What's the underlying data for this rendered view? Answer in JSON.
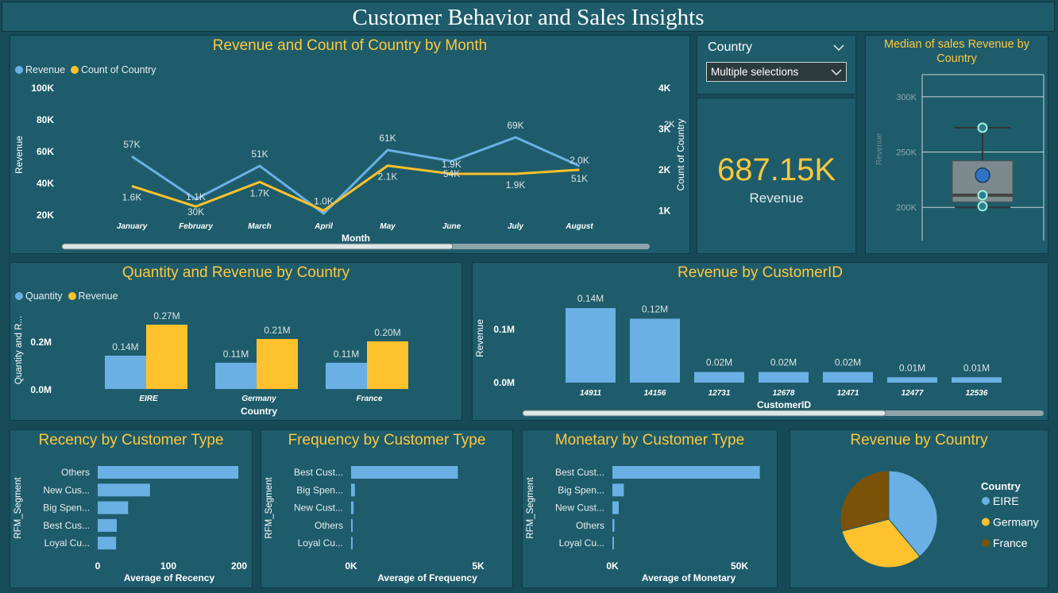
{
  "page_title": "Customer Behavior and Sales Insights",
  "colors": {
    "blue": "#6ab0e4",
    "yellow": "#ffc12c",
    "brown": "#7a5208",
    "title": "#ffc83d",
    "panel": "#1e5c6b",
    "background": "#164a57"
  },
  "slicer": {
    "label": "Country",
    "value": "Multiple selections",
    "icon": "chevron-down-icon"
  },
  "kpi": {
    "value": "687.15K",
    "label": "Revenue"
  },
  "chart_data": [
    {
      "id": "revenue_count_by_month",
      "type": "line",
      "title": "Revenue and Count of Country by Month",
      "xlabel": "Month",
      "ylabel": "Revenue",
      "y2label": "Count of Country",
      "categories": [
        "January",
        "February",
        "March",
        "April",
        "May",
        "June",
        "July",
        "August"
      ],
      "series": [
        {
          "name": "Revenue",
          "axis": "left",
          "values": [
            57000,
            30000,
            51000,
            21000,
            61000,
            54000,
            69000,
            51000
          ],
          "labels": [
            "57K",
            "30K",
            "51K",
            "",
            "61K",
            "54K",
            "69K",
            "51K"
          ]
        },
        {
          "name": "Count of Country",
          "axis": "right",
          "values": [
            1600,
            1100,
            1700,
            1000,
            2100,
            1900,
            1900,
            2000
          ],
          "labels": [
            "1.6K",
            "1.1K",
            "1.7K",
            "1.0K",
            "2.1K",
            "1.9K",
            "1.9K",
            "2.0K"
          ]
        }
      ],
      "yticks": [
        "20K",
        "40K",
        "60K",
        "80K",
        "100K"
      ],
      "y2ticks": [
        "1K",
        "2K",
        "3K",
        "4K"
      ],
      "ylim": [
        10000,
        100000
      ],
      "y2lim": [
        500,
        4000
      ],
      "partial_label": "2K",
      "legend": "top-left"
    },
    {
      "id": "median_sales_revenue_by_country",
      "type": "box",
      "title": "Median of sales Revenue by Country",
      "ylabel": "Revenue",
      "yticks": [
        "200K",
        "250K",
        "300K"
      ],
      "ylim": [
        170000,
        320000
      ],
      "whisker_min": 200000,
      "q1": 205000,
      "median": 211000,
      "q3": 242000,
      "whisker_max": 272000,
      "mean": 229000,
      "points": [
        272000,
        211000,
        201000
      ]
    },
    {
      "id": "quantity_revenue_by_country",
      "type": "bar",
      "title": "Quantity and Revenue by Country",
      "xlabel": "Country",
      "ylabel": "Quantity and R...",
      "categories": [
        "EIRE",
        "Germany",
        "France"
      ],
      "series": [
        {
          "name": "Quantity",
          "values": [
            140000,
            110000,
            110000
          ],
          "labels": [
            "0.14M",
            "0.11M",
            "0.11M"
          ]
        },
        {
          "name": "Revenue",
          "values": [
            270000,
            210000,
            200000
          ],
          "labels": [
            "0.27M",
            "0.21M",
            "0.20M"
          ]
        }
      ],
      "yticks": [
        "0.0M",
        "0.2M"
      ],
      "ylim": [
        0,
        300000
      ],
      "legend": "top-left"
    },
    {
      "id": "revenue_by_customerid",
      "type": "bar",
      "title": "Revenue by CustomerID",
      "xlabel": "CustomerID",
      "ylabel": "Revenue",
      "categories": [
        "14911",
        "14156",
        "12731",
        "12678",
        "12471",
        "12477",
        "12536"
      ],
      "values": [
        140000,
        120000,
        20000,
        20000,
        20000,
        10000,
        10000
      ],
      "labels": [
        "0.14M",
        "0.12M",
        "0.02M",
        "0.02M",
        "0.02M",
        "0.01M",
        "0.01M"
      ],
      "yticks": [
        "0.0M",
        "0.1M"
      ],
      "ylim": [
        0,
        155000
      ]
    },
    {
      "id": "recency_by_customer_type",
      "type": "bar",
      "orientation": "horizontal",
      "title": "Recency by Customer Type",
      "xlabel": "Average of Recency",
      "ylabel": "RFM_Segment",
      "categories": [
        "Others",
        "New Cus...",
        "Big Spen...",
        "Best Cus...",
        "Loyal Cu..."
      ],
      "values": [
        199,
        74,
        43,
        27,
        26
      ],
      "xticks": [
        "0",
        "100",
        "200"
      ],
      "xlim": [
        0,
        200
      ]
    },
    {
      "id": "frequency_by_customer_type",
      "type": "bar",
      "orientation": "horizontal",
      "title": "Frequency by Customer Type",
      "xlabel": "Average of Frequency",
      "ylabel": "RFM_Segment",
      "categories": [
        "Best Cust...",
        "Big Spen...",
        "New Cust...",
        "Others",
        "Loyal Cu..."
      ],
      "values": [
        4200,
        150,
        100,
        50,
        20
      ],
      "xticks": [
        "0K",
        "5K"
      ],
      "xlim": [
        0,
        5000
      ]
    },
    {
      "id": "monetary_by_customer_type",
      "type": "bar",
      "orientation": "horizontal",
      "title": "Monetary by Customer Type",
      "xlabel": "Average of Monetary",
      "ylabel": "RFM_Segment",
      "categories": [
        "Best Cust...",
        "Big Spen...",
        "New Cust...",
        "Others",
        "Loyal Cu..."
      ],
      "values": [
        58000,
        4500,
        2500,
        800,
        300
      ],
      "xticks": [
        "0K",
        "50K"
      ],
      "xlim": [
        0,
        50000
      ]
    },
    {
      "id": "revenue_by_country",
      "type": "pie",
      "title": "Revenue by Country",
      "legend_title": "Country",
      "categories": [
        "EIRE",
        "Germany",
        "France"
      ],
      "values": [
        39,
        32,
        29
      ],
      "colors": [
        "#6ab0e4",
        "#ffc12c",
        "#7a5208"
      ],
      "legend": "right"
    }
  ]
}
